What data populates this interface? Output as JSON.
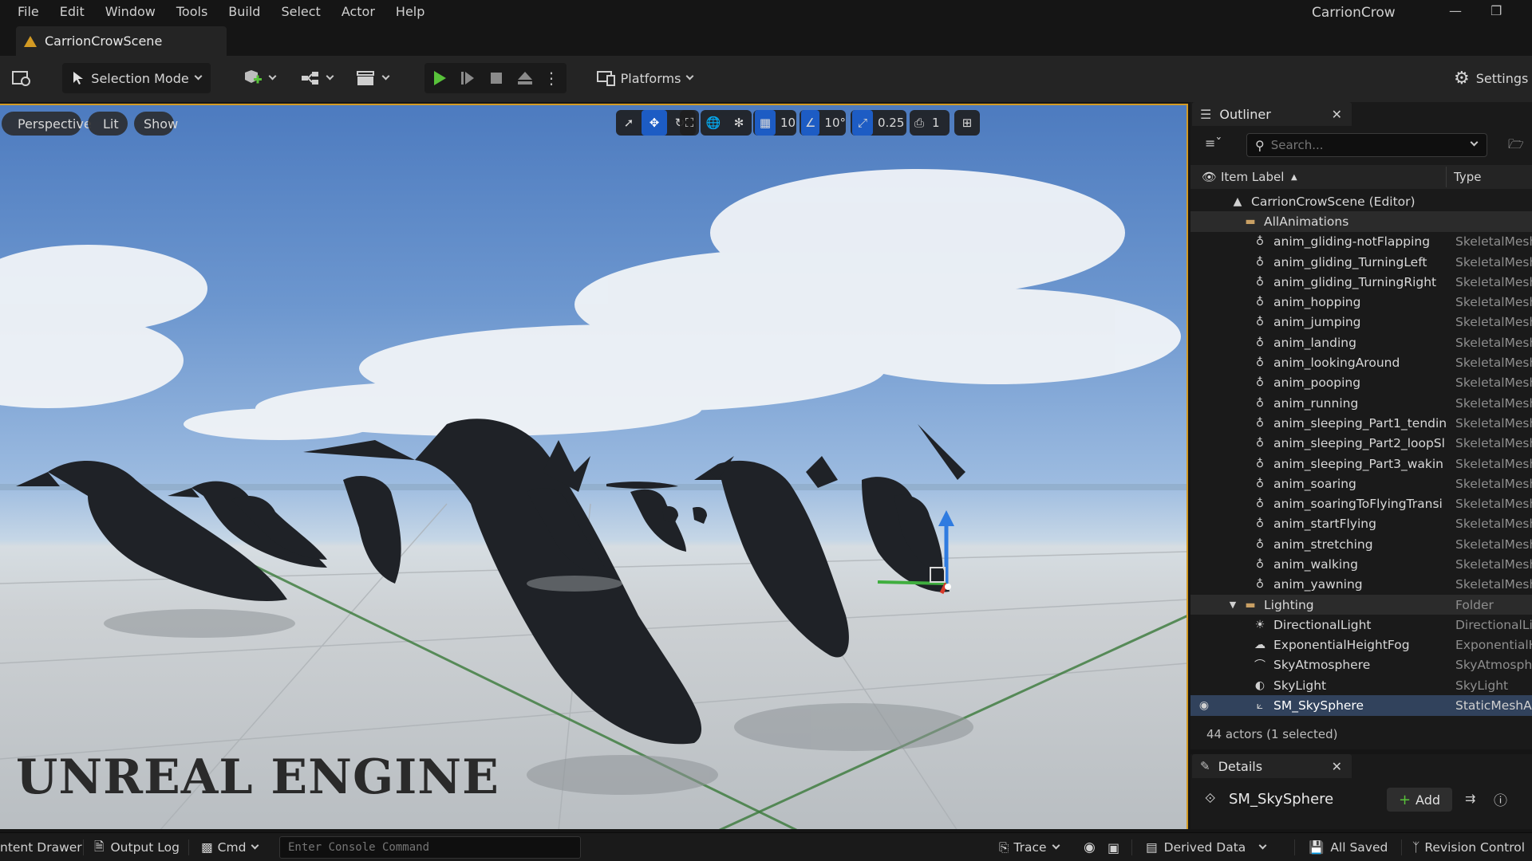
{
  "menu": [
    "File",
    "Edit",
    "Window",
    "Tools",
    "Build",
    "Select",
    "Actor",
    "Help"
  ],
  "app_title": "CarrionCrow",
  "level_tab": "CarrionCrowScene",
  "toolbar": {
    "selection_mode": "Selection Mode",
    "platforms": "Platforms",
    "settings": "Settings"
  },
  "viewport": {
    "perspective": "Perspective",
    "lit": "Lit",
    "show": "Show",
    "grid_snap": "10",
    "rotation_snap": "10°",
    "scale_snap": "0.25",
    "camera_speed": "1",
    "watermark": "UNREAL ENGINE"
  },
  "outliner": {
    "title": "Outliner",
    "search_placeholder": "Search...",
    "col_label": "Item Label",
    "col_type": "Type",
    "items": [
      {
        "label": "CarrionCrowScene (Editor)",
        "type": "",
        "icon": "level-icon",
        "indent": 0,
        "kind": "level"
      },
      {
        "label": "AllAnimations",
        "type": "",
        "icon": "folder-icon",
        "indent": 1,
        "kind": "folder"
      },
      {
        "label": "anim_gliding-notFlapping",
        "type": "SkeletalMesh",
        "icon": "skeletal-mesh-icon",
        "indent": 2
      },
      {
        "label": "anim_gliding_TurningLeft",
        "type": "SkeletalMesh",
        "icon": "skeletal-mesh-icon",
        "indent": 2
      },
      {
        "label": "anim_gliding_TurningRight",
        "type": "SkeletalMesh",
        "icon": "skeletal-mesh-icon",
        "indent": 2
      },
      {
        "label": "anim_hopping",
        "type": "SkeletalMesh",
        "icon": "skeletal-mesh-icon",
        "indent": 2
      },
      {
        "label": "anim_jumping",
        "type": "SkeletalMesh",
        "icon": "skeletal-mesh-icon",
        "indent": 2
      },
      {
        "label": "anim_landing",
        "type": "SkeletalMesh",
        "icon": "skeletal-mesh-icon",
        "indent": 2
      },
      {
        "label": "anim_lookingAround",
        "type": "SkeletalMesh",
        "icon": "skeletal-mesh-icon",
        "indent": 2
      },
      {
        "label": "anim_pooping",
        "type": "SkeletalMesh",
        "icon": "skeletal-mesh-icon",
        "indent": 2
      },
      {
        "label": "anim_running",
        "type": "SkeletalMesh",
        "icon": "skeletal-mesh-icon",
        "indent": 2
      },
      {
        "label": "anim_sleeping_Part1_tendin",
        "type": "SkeletalMesh",
        "icon": "skeletal-mesh-icon",
        "indent": 2
      },
      {
        "label": "anim_sleeping_Part2_loopSl",
        "type": "SkeletalMesh",
        "icon": "skeletal-mesh-icon",
        "indent": 2
      },
      {
        "label": "anim_sleeping_Part3_wakin",
        "type": "SkeletalMesh",
        "icon": "skeletal-mesh-icon",
        "indent": 2
      },
      {
        "label": "anim_soaring",
        "type": "SkeletalMesh",
        "icon": "skeletal-mesh-icon",
        "indent": 2
      },
      {
        "label": "anim_soaringToFlyingTransi",
        "type": "SkeletalMesh",
        "icon": "skeletal-mesh-icon",
        "indent": 2
      },
      {
        "label": "anim_startFlying",
        "type": "SkeletalMesh",
        "icon": "skeletal-mesh-icon",
        "indent": 2
      },
      {
        "label": "anim_stretching",
        "type": "SkeletalMesh",
        "icon": "skeletal-mesh-icon",
        "indent": 2
      },
      {
        "label": "anim_walking",
        "type": "SkeletalMesh",
        "icon": "skeletal-mesh-icon",
        "indent": 2
      },
      {
        "label": "anim_yawning",
        "type": "SkeletalMesh",
        "icon": "skeletal-mesh-icon",
        "indent": 2
      },
      {
        "label": "Lighting",
        "type": "Folder",
        "icon": "folder-icon",
        "indent": 1,
        "kind": "folder-open"
      },
      {
        "label": "DirectionalLight",
        "type": "DirectionalLig",
        "icon": "directional-light-icon",
        "indent": 2
      },
      {
        "label": "ExponentialHeightFog",
        "type": "ExponentialH",
        "icon": "fog-icon",
        "indent": 2
      },
      {
        "label": "SkyAtmosphere",
        "type": "SkyAtmosphe",
        "icon": "sky-atmosphere-icon",
        "indent": 2
      },
      {
        "label": "SkyLight",
        "type": "SkyLight",
        "icon": "skylight-icon",
        "indent": 2
      },
      {
        "label": "SM_SkySphere",
        "type": "StaticMeshAc",
        "icon": "static-mesh-icon",
        "indent": 2,
        "kind": "selected"
      }
    ],
    "actor_count": "44 actors (1 selected)"
  },
  "details": {
    "title": "Details",
    "actor_name": "SM_SkySphere",
    "add_label": "Add"
  },
  "statusbar": {
    "content_drawer": "ntent Drawer",
    "output_log": "Output Log",
    "cmd": "Cmd",
    "console_placeholder": "Enter Console Command",
    "trace": "Trace",
    "derived_data": "Derived Data",
    "all_saved": "All Saved",
    "revision_control": "Revision Control"
  },
  "colors": {
    "accent_orange": "#d39a23",
    "play_green": "#58c23a",
    "selection_blue": "#31425c"
  }
}
